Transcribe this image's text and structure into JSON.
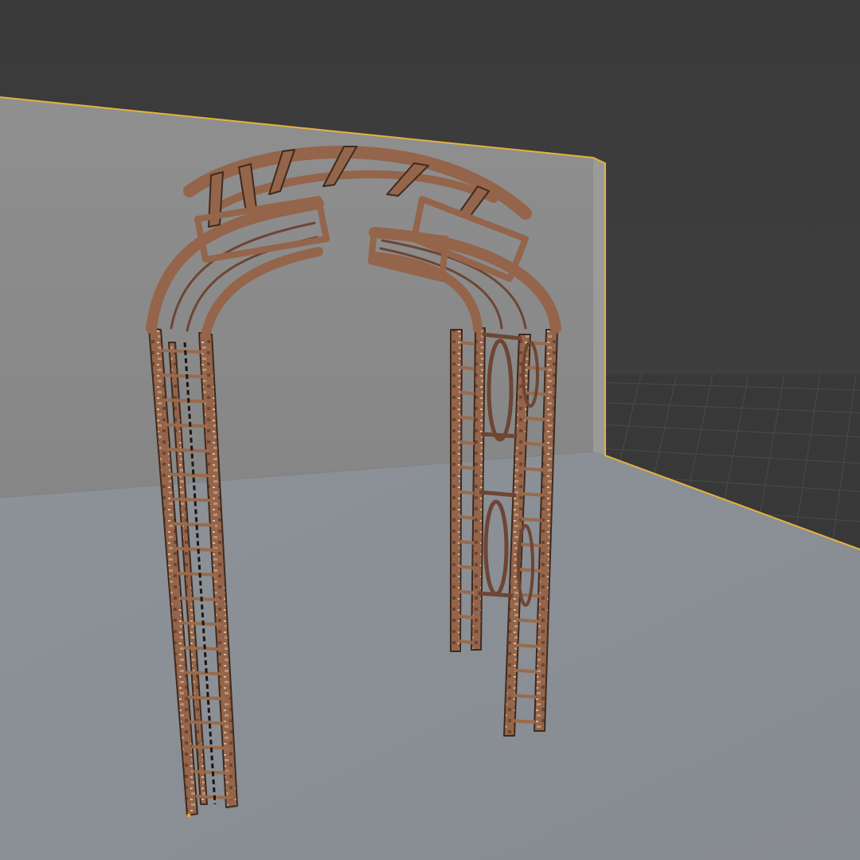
{
  "viewport": {
    "mode": "3D viewport",
    "colors": {
      "background": "#3d3d3d",
      "grid_floor": "#383838",
      "grid_line": "#4a4a4a",
      "backdrop_wall": "#8a8a8a",
      "backdrop_floor": "#8c9198",
      "selection_outline": "#e3b33a",
      "metal_rust": "#9a6a4a",
      "metal_dark": "#3f2a1e",
      "metal_highlight": "#d9c3ad"
    }
  },
  "scene": {
    "objects": [
      {
        "name": "backdrop-plane",
        "selected": true
      },
      {
        "name": "garden-arch",
        "selected": false
      }
    ]
  },
  "icons": {
    "object_origin": "origin-dot-icon"
  }
}
